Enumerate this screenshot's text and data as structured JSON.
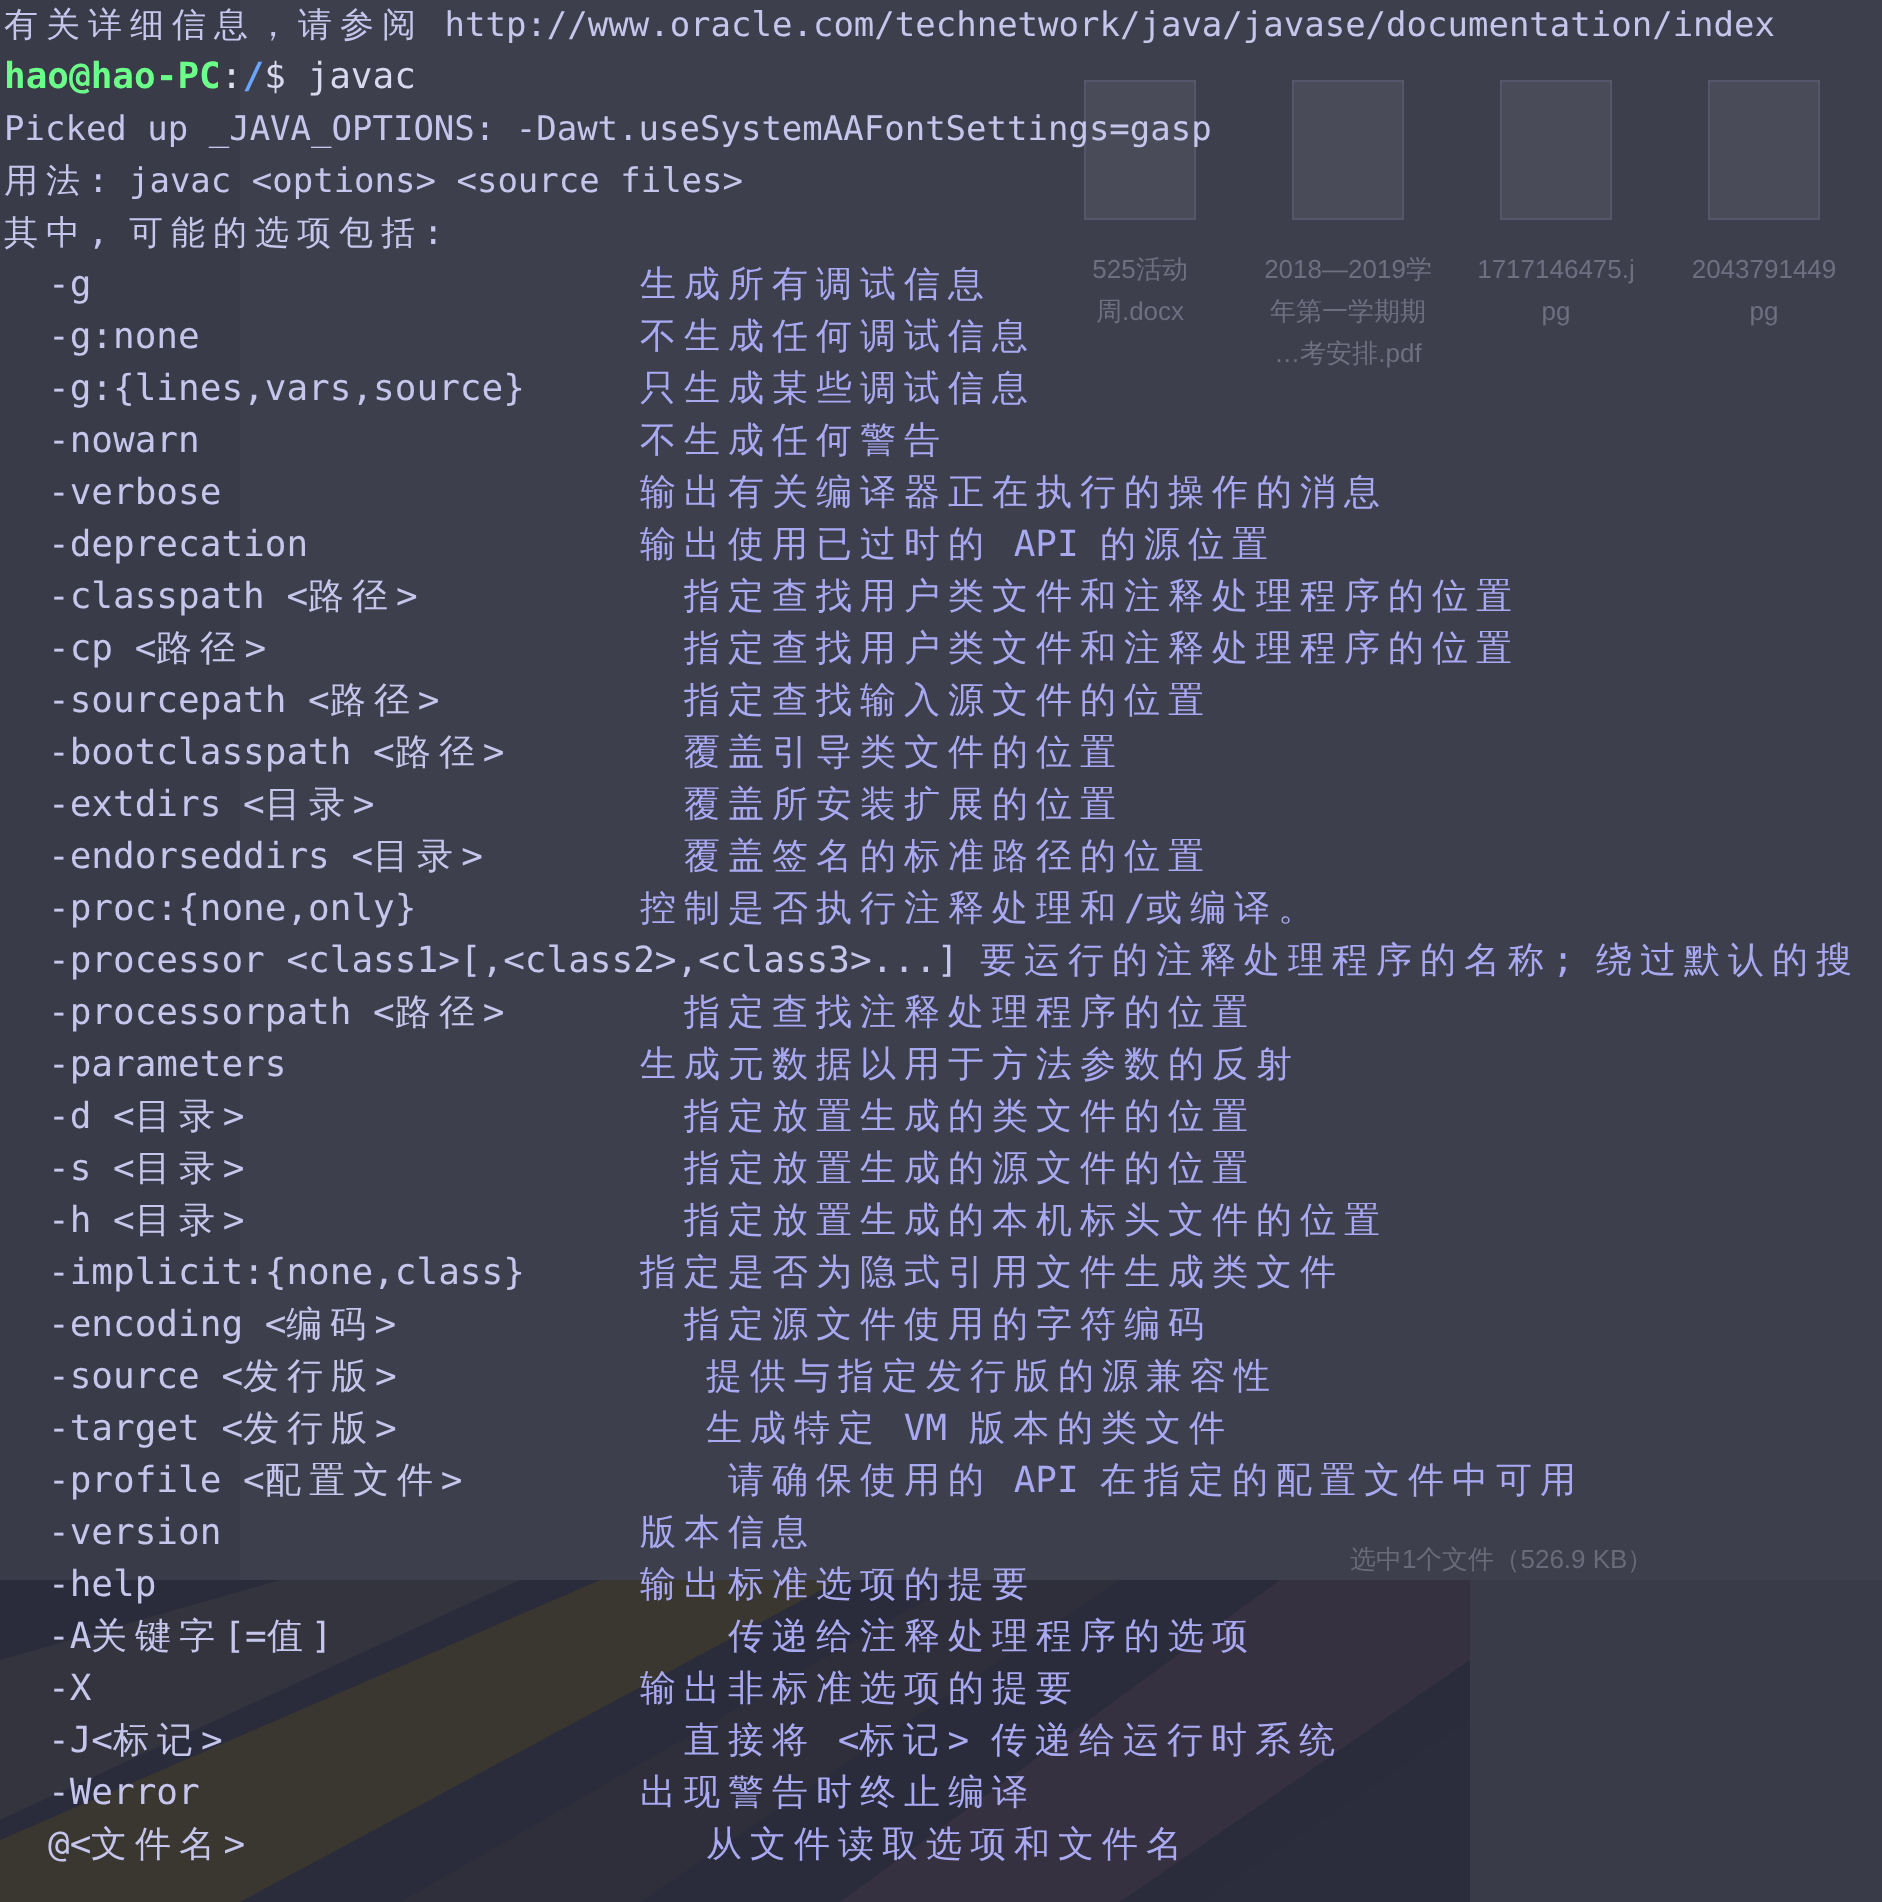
{
  "file_manager": {
    "files": [
      {
        "name_lines": [
          "525活动",
          "周.docx"
        ]
      },
      {
        "name_lines": [
          "2018—2019学",
          "年第一学期期",
          "…考安排.pdf"
        ]
      },
      {
        "name_lines": [
          "1717146475.j",
          "pg"
        ]
      },
      {
        "name_lines": [
          "2043791449",
          "pg"
        ]
      }
    ],
    "status": "选中1个文件（526.9 KB）"
  },
  "terminal": {
    "lines": [
      {
        "kind": "text",
        "text": "有关详细信息，请参阅 http://www.oracle.com/technetwork/java/javase/documentation/index"
      },
      {
        "kind": "prompt",
        "user_host": "hao@hao-PC",
        "separator": ":",
        "path": "/",
        "command": "$ javac"
      },
      {
        "kind": "text",
        "text": "Picked up _JAVA_OPTIONS:   -Dawt.useSystemAAFontSettings=gasp"
      },
      {
        "kind": "text",
        "text": "用法: javac <options> <source files>"
      },
      {
        "kind": "text",
        "text": "其中, 可能的选项包括:"
      }
    ],
    "options": [
      {
        "option": "-g",
        "description": "生成所有调试信息"
      },
      {
        "option": "-g:none",
        "description": "不生成任何调试信息"
      },
      {
        "option": "-g:{lines,vars,source}",
        "description": "只生成某些调试信息"
      },
      {
        "option": "-nowarn",
        "description": "不生成任何警告"
      },
      {
        "option": "-verbose",
        "description": "输出有关编译器正在执行的操作的消息"
      },
      {
        "option": "-deprecation",
        "description": "输出使用已过时的 API 的源位置"
      },
      {
        "option": "-classpath <路径>",
        "description": "指定查找用户类文件和注释处理程序的位置"
      },
      {
        "option": "-cp <路径>",
        "description": "指定查找用户类文件和注释处理程序的位置"
      },
      {
        "option": "-sourcepath <路径>",
        "description": "指定查找输入源文件的位置"
      },
      {
        "option": "-bootclasspath <路径>",
        "description": "覆盖引导类文件的位置"
      },
      {
        "option": "-extdirs <目录>",
        "description": "覆盖所安装扩展的位置"
      },
      {
        "option": "-endorseddirs <目录>",
        "description": "覆盖签名的标准路径的位置"
      },
      {
        "option": "-proc:{none,only}",
        "description": "控制是否执行注释处理和/或编译。"
      },
      {
        "option": "-processor <class1>[,<class2>,<class3>...]",
        "description": "要运行的注释处理程序的名称; 绕过默认的搜"
      },
      {
        "option": "-processorpath <路径>",
        "description": "指定查找注释处理程序的位置"
      },
      {
        "option": "-parameters",
        "description": "生成元数据以用于方法参数的反射"
      },
      {
        "option": "-d <目录>",
        "description": "指定放置生成的类文件的位置"
      },
      {
        "option": "-s <目录>",
        "description": "指定放置生成的源文件的位置"
      },
      {
        "option": "-h <目录>",
        "description": "指定放置生成的本机标头文件的位置"
      },
      {
        "option": "-implicit:{none,class}",
        "description": "指定是否为隐式引用文件生成类文件"
      },
      {
        "option": "-encoding <编码>",
        "description": "指定源文件使用的字符编码"
      },
      {
        "option": "-source <发行版>",
        "description": "提供与指定发行版的源兼容性"
      },
      {
        "option": "-target <发行版>",
        "description": "生成特定 VM 版本的类文件"
      },
      {
        "option": "-profile <配置文件>",
        "description": "请确保使用的 API 在指定的配置文件中可用"
      },
      {
        "option": "-version",
        "description": "版本信息"
      },
      {
        "option": "-help",
        "description": "输出标准选项的提要"
      },
      {
        "option": "-A关键字[=值]",
        "description": "传递给注释处理程序的选项"
      },
      {
        "option": "-X",
        "description": "输出非标准选项的提要"
      },
      {
        "option": "-J<标记>",
        "description": "直接将 <标记> 传递给运行时系统"
      },
      {
        "option": "-Werror",
        "description": "出现警告时终止编译"
      },
      {
        "option": "@<文件名>",
        "description": "从文件读取选项和文件名"
      }
    ]
  }
}
